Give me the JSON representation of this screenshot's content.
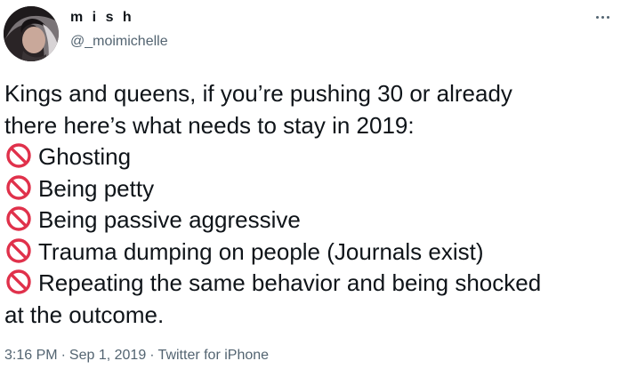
{
  "author": {
    "display_name": "m i s h",
    "handle": "@_moimichelle"
  },
  "tweet": {
    "intro_line1": "Kings and queens, if you’re pushing 30 or already",
    "intro_line2": "there here’s what needs to stay in 2019:",
    "items": [
      "Ghosting",
      "Being petty",
      "Being passive aggressive",
      "Trauma dumping on people (Journals exist)",
      "Repeating the same behavior and being shocked"
    ],
    "last_item_continuation": "at the outcome.",
    "bullet_icon": "no-entry-emoji"
  },
  "meta": {
    "time": "3:16 PM",
    "separator": "·",
    "date": "Sep 1, 2019",
    "source": "Twitter for iPhone"
  },
  "colors": {
    "text": "#0f1419",
    "secondary": "#536471",
    "no_entry_red": "#e0314b"
  },
  "icons": {
    "more": "more-horizontal-icon",
    "bullet": "no-entry-emoji"
  }
}
